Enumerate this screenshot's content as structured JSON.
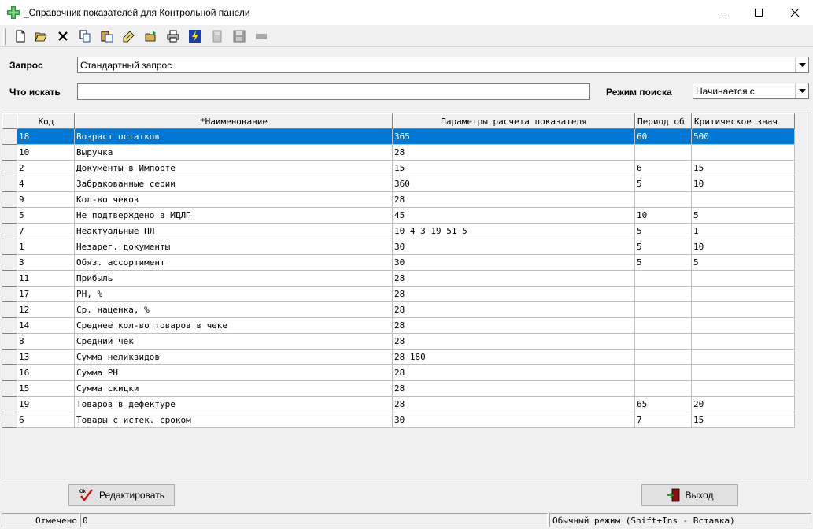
{
  "window": {
    "title": "_Справочник показателей для Контрольной панели"
  },
  "filter": {
    "query_label": "Запрос",
    "query_value": "Стандартный запрос",
    "search_label": "Что искать",
    "search_value": "",
    "mode_label": "Режим поиска",
    "mode_value": "Начинается с"
  },
  "table": {
    "columns": [
      "Код",
      "*Наименование",
      "Параметры расчета показателя",
      "Период об",
      "Критическое знач"
    ],
    "rows": [
      [
        "18",
        "Возраст остатков",
        "365",
        "60",
        "500"
      ],
      [
        "10",
        "Выручка",
        "28",
        "",
        ""
      ],
      [
        "2",
        "Документы в Импорте",
        "15",
        "6",
        "15"
      ],
      [
        "4",
        "Забракованные серии",
        "360",
        "5",
        "10"
      ],
      [
        "9",
        "Кол-во чеков",
        "28",
        "",
        ""
      ],
      [
        "5",
        "Не подтверждено в МДЛП",
        "45",
        "10",
        "5"
      ],
      [
        "7",
        "Неактуальные ПЛ",
        "10 4 3 19 51 5",
        "5",
        "1"
      ],
      [
        "1",
        "Незарег. документы",
        "30",
        "5",
        "10"
      ],
      [
        "3",
        "Обяз. ассортимент",
        "30",
        "5",
        "5"
      ],
      [
        "11",
        "Прибыль",
        "28",
        "",
        ""
      ],
      [
        "17",
        "РН, %",
        "28",
        "",
        ""
      ],
      [
        "12",
        "Ср. наценка, %",
        "28",
        "",
        ""
      ],
      [
        "14",
        "Среднее кол-во товаров в чеке",
        "28",
        "",
        ""
      ],
      [
        "8",
        "Средний чек",
        "28",
        "",
        ""
      ],
      [
        "13",
        "Сумма неликвидов",
        "28 180",
        "",
        ""
      ],
      [
        "16",
        "Сумма РН",
        "28",
        "",
        ""
      ],
      [
        "15",
        "Сумма скидки",
        "28",
        "",
        ""
      ],
      [
        "19",
        "Товаров в дефектуре",
        "28",
        "65",
        "20"
      ],
      [
        "6",
        "Товары с истек. сроком",
        "30",
        "7",
        "15"
      ]
    ],
    "selected_row": 0
  },
  "buttons": {
    "edit": "Редактировать",
    "exit": "Выход"
  },
  "statusbar": {
    "marked_label": "Отмечено",
    "marked_value": "0",
    "mode_text": "Обычный режим (Shift+Ins - Вставка)"
  },
  "colors": {
    "selection": "#0078d7",
    "accent_green": "#2e9b3a"
  },
  "icons": {
    "app": "green-plus-icon",
    "toolbar": [
      "new-doc-icon",
      "open-folder-icon",
      "delete-icon",
      "copy-icon",
      "paste-icon",
      "edit-note-icon",
      "folder-open-icon",
      "print-icon",
      "lightning-icon",
      "disabled-doc-icon",
      "disabled-save-icon",
      "disabled-bar-icon"
    ]
  }
}
